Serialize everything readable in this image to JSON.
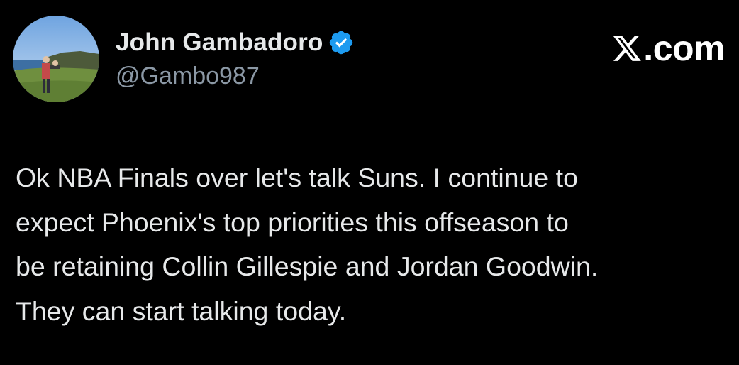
{
  "author": {
    "display_name": "John Gambadoro",
    "handle": "@Gambo987",
    "verified": true,
    "avatar": "profile-photo-coastal-cliffs"
  },
  "brand": {
    "text": ".com",
    "icon": "x-logo-icon"
  },
  "tweet": {
    "lines": [
      "Ok NBA Finals over let's talk Suns. I continue to",
      "expect Phoenix's top priorities this offseason to",
      "be retaining Collin Gillespie and Jordan Goodwin.",
      "They can start talking today."
    ]
  },
  "colors": {
    "background": "#000000",
    "text": "#e7e9ea",
    "secondary": "#8b98a5",
    "verified_badge": "#1d9bf0"
  }
}
